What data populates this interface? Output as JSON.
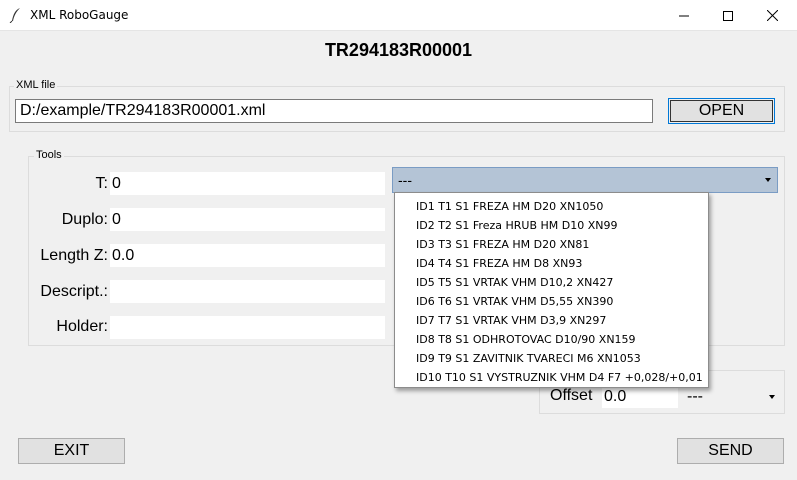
{
  "window": {
    "title": "XML RoboGauge",
    "icon": "feather-icon",
    "controls": [
      "minimize-icon",
      "maximize-icon",
      "close-icon"
    ]
  },
  "header": {
    "title": "TR294183R00001"
  },
  "xml_file": {
    "group_label": "XML file",
    "path_value": "D:/example/TR294183R00001.xml",
    "open_label": "OPEN"
  },
  "tools": {
    "group_label": "Tools",
    "fields": [
      {
        "label": "T:",
        "value": "0"
      },
      {
        "label": "Duplo:",
        "value": "0"
      },
      {
        "label": "Length Z:",
        "value": "0.0"
      },
      {
        "label": "Descript.:",
        "value": ""
      },
      {
        "label": "Holder:",
        "value": ""
      }
    ],
    "combo_value": "---",
    "dropdown_items": [
      "ID1  T1  S1  FREZA HM D20 XN1050",
      "ID2  T2  S1  Freza HRUB HM D10 XN99",
      "ID3  T3  S1  FREZA HM D20 XN81",
      "ID4  T4  S1  FREZA HM D8 XN93",
      "ID5  T5  S1  VRTAK VHM D10,2 XN427",
      "ID6  T6  S1  VRTAK VHM D5,55 XN390",
      "ID7  T7  S1  VRTAK VHM D3,9 XN297",
      "ID8  T8  S1  ODHROTOVAC D10/90 XN159",
      "ID9  T9  S1  ZAVITNIK TVARECI M6 XN1053",
      "ID10  T10  S1  VYSTRUZNIK VHM D4 F7 +0,028/+0,01"
    ]
  },
  "offset": {
    "label": "Offset",
    "value": "0.0",
    "combo_value": "---"
  },
  "footer": {
    "exit_label": "EXIT",
    "send_label": "SEND"
  },
  "colors": {
    "combo_selected_bg": "#b4c4d6",
    "window_bg": "#f0f0f0",
    "focus_border": "#0078d7"
  }
}
